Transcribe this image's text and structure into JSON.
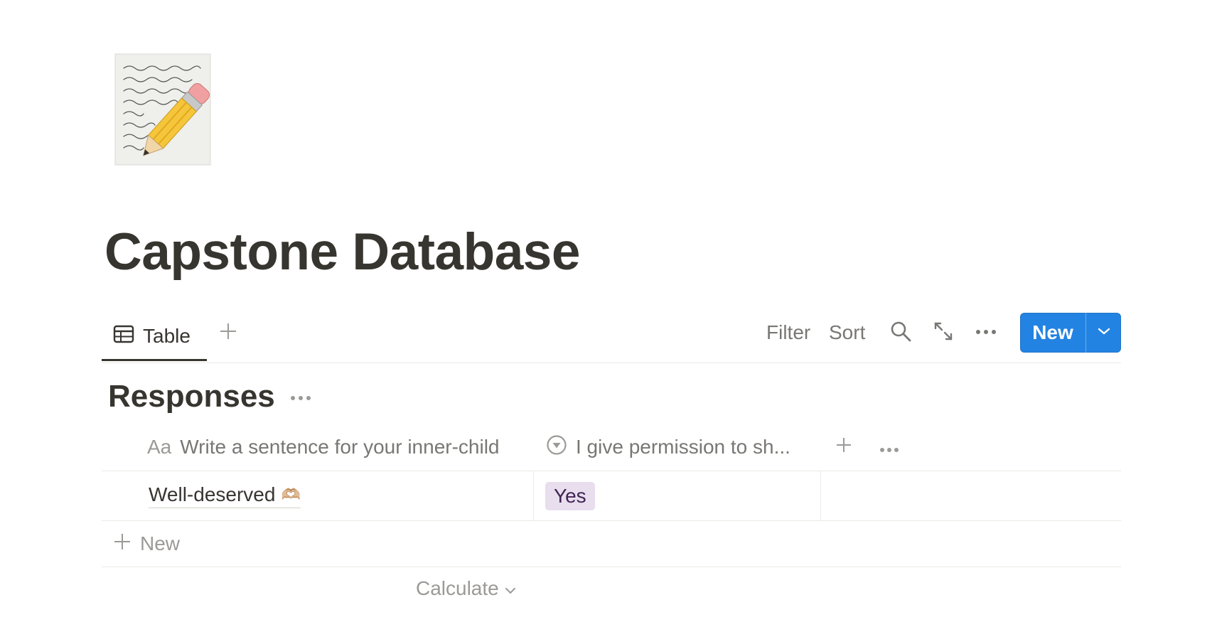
{
  "page": {
    "title": "Capstone Database",
    "icon": "notepad-with-pencil-icon"
  },
  "view": {
    "tab_label": "Table",
    "tab_icon": "table-icon",
    "add_view_icon": "plus-icon"
  },
  "toolbar": {
    "filter_label": "Filter",
    "sort_label": "Sort",
    "search_icon": "search-icon",
    "expand_icon": "expand-icon",
    "more_icon": "more-icon",
    "new_label": "New",
    "new_dropdown_icon": "chevron-down-icon",
    "new_button_color": "#2383e2"
  },
  "database": {
    "title": "Responses",
    "more_icon": "more-icon"
  },
  "table": {
    "columns": [
      {
        "icon": "Aa",
        "label": "Write a sentence for your inner-child"
      },
      {
        "icon": "select-icon",
        "label": "I give permission to sh..."
      }
    ],
    "add_column_icon": "plus-icon",
    "columns_more_icon": "more-icon",
    "rows": [
      {
        "name": "Well-deserved",
        "name_emoji": "🫶🏼",
        "permission": "Yes",
        "permission_color": "#e8deee"
      }
    ],
    "new_row_label": "New",
    "calculate_label": "Calculate"
  }
}
